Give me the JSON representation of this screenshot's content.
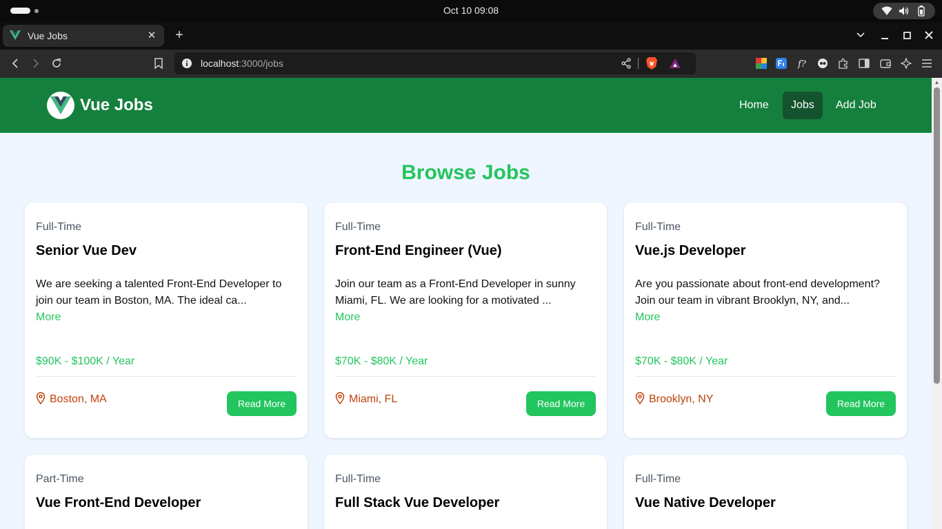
{
  "os": {
    "clock": "Oct 10  09:08",
    "tray_icons": [
      "wifi-icon",
      "volume-icon",
      "battery-icon"
    ]
  },
  "browser": {
    "tab_title": "Vue Jobs",
    "url_host": "localhost",
    "url_path": ":3000/jobs"
  },
  "nav": {
    "brand": "Vue Jobs",
    "links": [
      "Home",
      "Jobs",
      "Add Job"
    ],
    "active_link": "Jobs",
    "color": "#15803d"
  },
  "heading": "Browse Jobs",
  "jobs": [
    {
      "type": "Full-Time",
      "title": "Senior Vue Dev",
      "description": "We are seeking a talented Front-End Developer to join our team in Boston, MA. The ideal ca...",
      "more": "More",
      "salary": "$90K - $100K / Year",
      "location": "Boston, MA",
      "button": "Read More"
    },
    {
      "type": "Full-Time",
      "title": "Front-End Engineer (Vue)",
      "description": "Join our team as a Front-End Developer in sunny Miami, FL. We are looking for a motivated ...",
      "more": "More",
      "salary": "$70K - $80K / Year",
      "location": "Miami, FL",
      "button": "Read More"
    },
    {
      "type": "Full-Time",
      "title": "Vue.js Developer",
      "description": "Are you passionate about front-end development? Join our team in vibrant Brooklyn, NY, and...",
      "more": "More",
      "salary": "$70K - $80K / Year",
      "location": "Brooklyn, NY",
      "button": "Read More"
    },
    {
      "type": "Part-Time",
      "title": "Vue Front-End Developer"
    },
    {
      "type": "Full-Time",
      "title": "Full Stack Vue Developer"
    },
    {
      "type": "Full-Time",
      "title": "Vue Native Developer"
    }
  ],
  "colors": {
    "accent": "#22c55e",
    "location": "#c2410c",
    "page_bg": "#eff6ff"
  }
}
